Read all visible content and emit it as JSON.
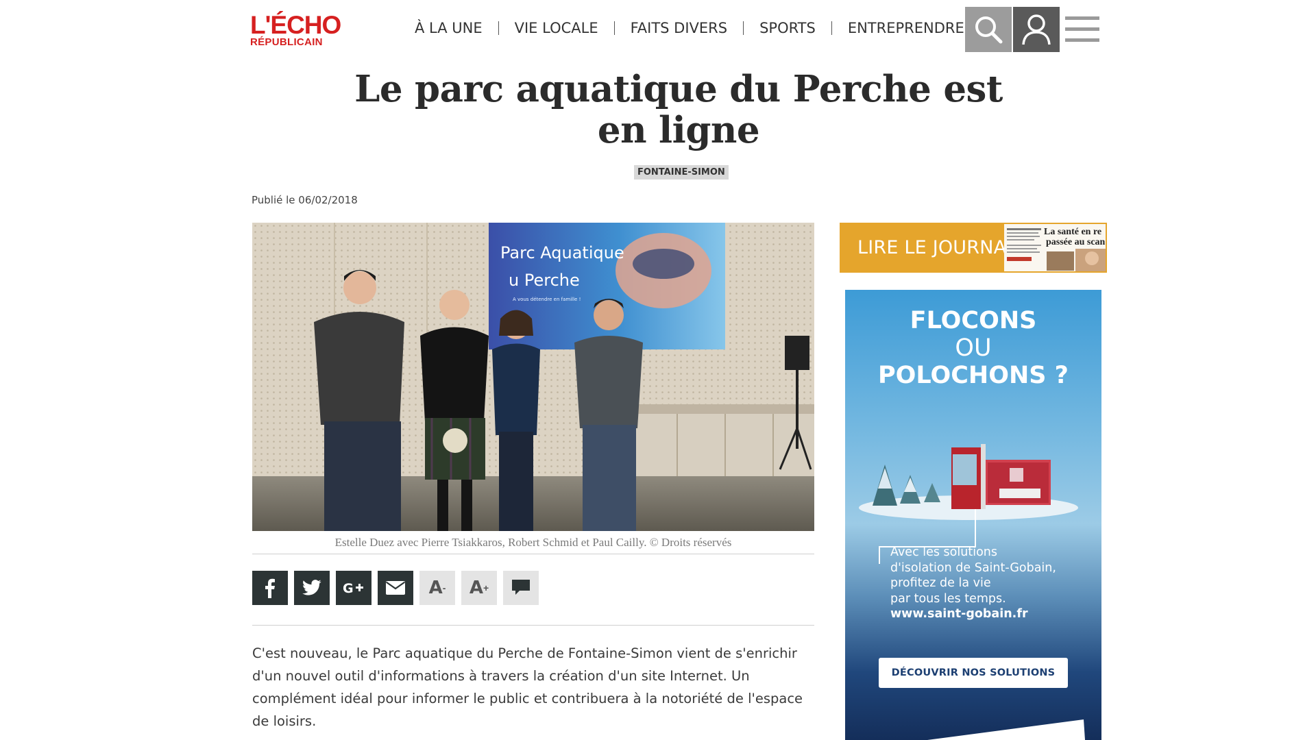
{
  "header": {
    "logo_main": "L'ÉCHO",
    "logo_sub": "RÉPUBLICAIN",
    "nav": [
      "À LA UNE",
      "VIE LOCALE",
      "FAITS DIVERS",
      "SPORTS",
      "ENTREPRENDRE"
    ],
    "icons": [
      "search-icon",
      "user-icon",
      "menu-icon"
    ]
  },
  "article": {
    "title": "Le parc aquatique du Perche est en ligne",
    "tag": "FONTAINE-SIMON",
    "published": "Publié le 06/02/2018",
    "photo": {
      "screen_title_line1": "Parc Aquatique",
      "screen_title_line2": "u Perche",
      "screen_subtitle": "A vous détendre en famille !"
    },
    "caption": "Estelle Duez avec Pierre Tsiakkaros, Robert Schmid et Paul Cailly. © Droits réservés",
    "share_buttons": {
      "font_smaller": "A",
      "font_larger": "A",
      "icons": [
        "facebook-icon",
        "twitter-icon",
        "google-plus-icon",
        "email-icon",
        "comment-icon"
      ]
    },
    "body": "C'est nouveau, le Parc aquatique du Perche de Fontaine-Simon vient de s'enrichir d'un nouvel outil d'informations à travers la création d'un site Internet. Un complément idéal pour informer le public et contribuera à la notoriété de l'espace de loisirs."
  },
  "sidebar": {
    "lire_label": "LIRE LE JOURNAL",
    "thumb_headline_1": "La santé en re",
    "thumb_headline_2": "passée au scan",
    "ad": {
      "headline_1": "FLOCONS",
      "headline_2": "OU",
      "headline_3": "POLOCHONS ?",
      "text_1": "Avec les solutions",
      "text_2": "d'isolation de Saint-Gobain,",
      "text_3": "profitez de la vie",
      "text_4": "par tous les temps.",
      "url": "www.saint-gobain.fr",
      "cta": "DÉCOUVRIR NOS SOLUTIONS"
    }
  },
  "colors": {
    "brand_red": "#d62020",
    "lire_orange": "#e5a52c",
    "share_dark": "#2c3435",
    "share_light": "#e4e4e4",
    "ad_navy": "#1c3f72"
  }
}
